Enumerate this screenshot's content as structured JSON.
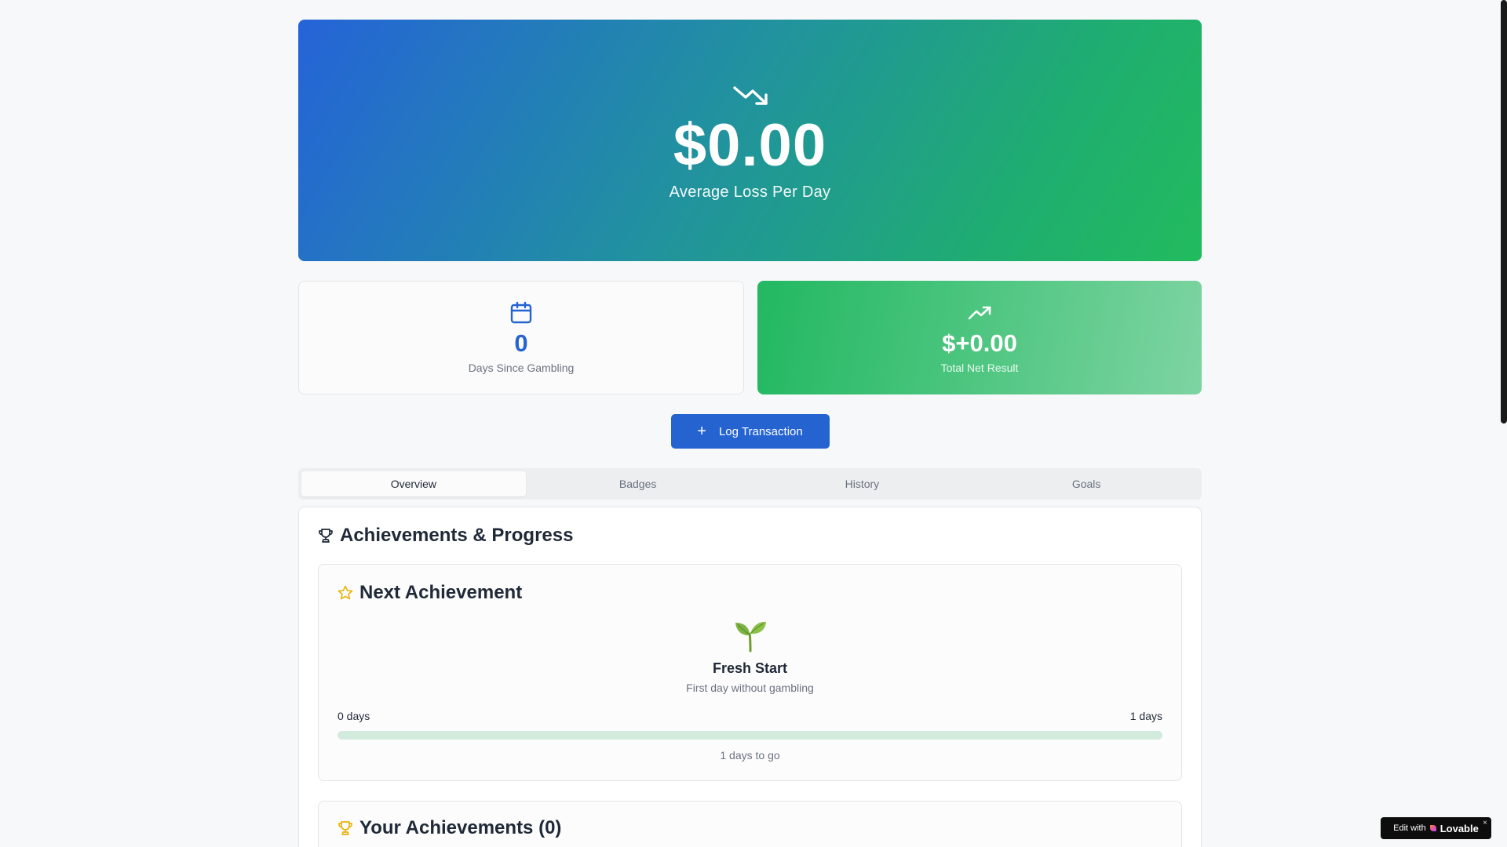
{
  "hero": {
    "icon": "trending-down-icon",
    "amount": "$0.00",
    "label": "Average Loss Per Day"
  },
  "stats": {
    "days": {
      "icon": "calendar-icon",
      "value": "0",
      "label": "Days Since Gambling"
    },
    "net": {
      "icon": "trending-up-icon",
      "value": "$+0.00",
      "label": "Total Net Result"
    }
  },
  "log_button": {
    "icon": "plus-icon",
    "label": "Log Transaction"
  },
  "tabs": [
    {
      "label": "Overview",
      "active": true
    },
    {
      "label": "Badges",
      "active": false
    },
    {
      "label": "History",
      "active": false
    },
    {
      "label": "Goals",
      "active": false
    }
  ],
  "achievements": {
    "icon": "trophy-icon",
    "title": "Achievements & Progress",
    "next": {
      "icon": "star-icon",
      "title": "Next Achievement",
      "badge_icon": "seedling-icon",
      "name": "Fresh Start",
      "description": "First day without gambling",
      "start_label": "0 days",
      "end_label": "1 days",
      "progress_fraction": 0,
      "remaining": "1 days to go"
    },
    "yours": {
      "icon": "trophy-icon",
      "title": "Your Achievements (0)"
    }
  },
  "lovable_badge": {
    "prefix": "Edit with",
    "brand": "Lovable",
    "close": "×"
  },
  "colors": {
    "primary": "#2563d0",
    "success": "#22b861",
    "accent_yellow": "#eab308",
    "background": "#f7f8f9"
  }
}
